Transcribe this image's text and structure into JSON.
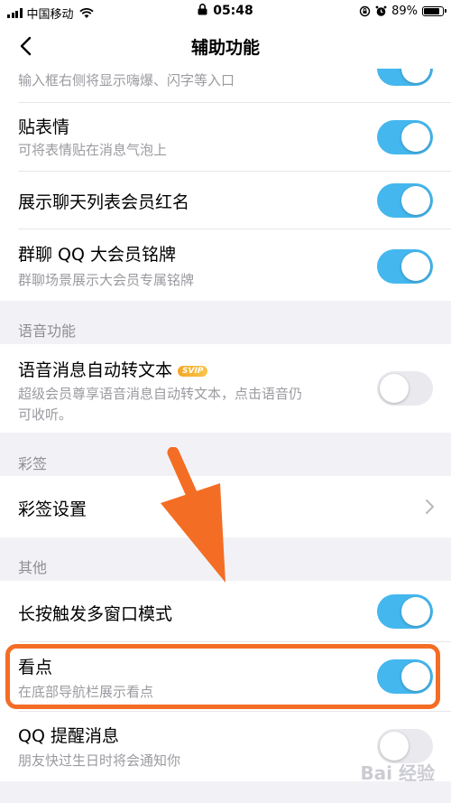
{
  "status_bar": {
    "carrier": "中国移动",
    "time": "05:48",
    "battery": "89%"
  },
  "nav": {
    "title": "辅助功能"
  },
  "rows": [
    {
      "subtitle": "输入框右侧将显示嗨爆、闪字等入口",
      "toggle": "on"
    },
    {
      "title": "贴表情",
      "subtitle": "可将表情贴在消息气泡上",
      "toggle": "on"
    },
    {
      "title": "展示聊天列表会员红名",
      "toggle": "on"
    },
    {
      "title": "群聊 QQ 大会员铭牌",
      "subtitle": "群聊场景展示大会员专属铭牌",
      "toggle": "on"
    }
  ],
  "voice_section": {
    "header": "语音功能",
    "title": "语音消息自动转文本",
    "badge": "SVIP",
    "subtitle_line1": "超级会员尊享语音消息自动转文本，点击语音仍",
    "subtitle_line2": "可收听。",
    "toggle": "off"
  },
  "caiqian_section": {
    "header": "彩签",
    "title": "彩签设置"
  },
  "other_section": {
    "header": "其他",
    "rows": [
      {
        "title": "长按触发多窗口模式",
        "toggle": "on"
      },
      {
        "title": "看点",
        "subtitle": "在底部导航栏展示看点",
        "toggle": "on"
      },
      {
        "title": "QQ 提醒消息",
        "subtitle": "朋友快过生日时将会通知你",
        "toggle": "off"
      }
    ]
  },
  "watermark": "Bai 经验",
  "colors": {
    "toggle_on": "#44b7ee",
    "highlight": "#f46d25"
  }
}
